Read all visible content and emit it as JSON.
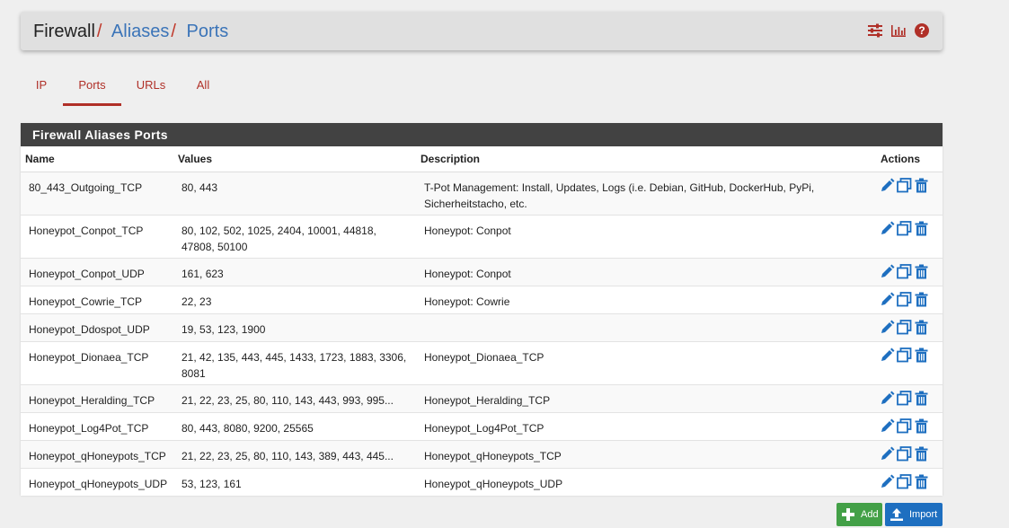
{
  "breadcrumb": {
    "first": "Firewall",
    "second": "Aliases",
    "third": "Ports",
    "separator": "/"
  },
  "header_icons": [
    "sliders-icon",
    "bar-chart-icon",
    "help-icon"
  ],
  "tabs": [
    {
      "label": "IP",
      "active": false
    },
    {
      "label": "Ports",
      "active": true
    },
    {
      "label": "URLs",
      "active": false
    },
    {
      "label": "All",
      "active": false
    }
  ],
  "panel": {
    "title": "Firewall Aliases Ports",
    "columns": {
      "name": "Name",
      "values": "Values",
      "description": "Description",
      "actions": "Actions"
    },
    "rows": [
      {
        "name": "80_443_Outgoing_TCP",
        "values": "80, 443",
        "description": "T-Pot Management: Install, Updates, Logs (i.e. Debian, GitHub, DockerHub, PyPi, Sicherheitstacho, etc."
      },
      {
        "name": "Honeypot_Conpot_TCP",
        "values": "80, 102, 502, 1025, 2404, 10001, 44818, 47808, 50100",
        "description": "Honeypot: Conpot"
      },
      {
        "name": "Honeypot_Conpot_UDP",
        "values": "161, 623",
        "description": "Honeypot: Conpot"
      },
      {
        "name": "Honeypot_Cowrie_TCP",
        "values": "22, 23",
        "description": "Honeypot: Cowrie"
      },
      {
        "name": "Honeypot_Ddospot_UDP",
        "values": "19, 53, 123, 1900",
        "description": ""
      },
      {
        "name": "Honeypot_Dionaea_TCP",
        "values": "21, 42, 135, 443, 445, 1433, 1723, 1883, 3306, 8081",
        "description": "Honeypot_Dionaea_TCP"
      },
      {
        "name": "Honeypot_Heralding_TCP",
        "values": "21, 22, 23, 25, 80, 110, 143, 443, 993, 995...",
        "description": "Honeypot_Heralding_TCP"
      },
      {
        "name": "Honeypot_Log4Pot_TCP",
        "values": "80, 443, 8080, 9200, 25565",
        "description": "Honeypot_Log4Pot_TCP"
      },
      {
        "name": "Honeypot_qHoneypots_TCP",
        "values": "21, 22, 23, 25, 80, 110, 143, 389, 443, 445...",
        "description": "Honeypot_qHoneypots_TCP"
      },
      {
        "name": "Honeypot_qHoneypots_UDP",
        "values": "53, 123, 161",
        "description": "Honeypot_qHoneypots_UDP"
      }
    ]
  },
  "buttons": {
    "add": "Add",
    "import": "Import"
  },
  "colors": {
    "accent_red": "#b03028",
    "link_blue": "#3b74b8",
    "icon_blue": "#1e6fc0",
    "add_green": "#43a047",
    "panel_heading": "#424242"
  }
}
